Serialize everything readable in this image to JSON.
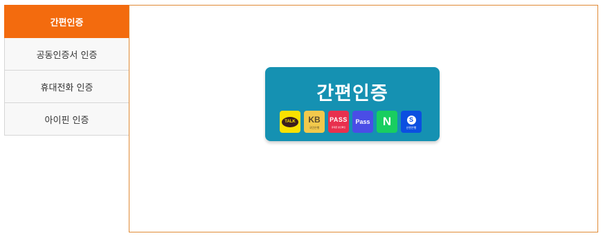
{
  "tabs": [
    {
      "label": "간편인증",
      "active": true
    },
    {
      "label": "공동인증서 인증",
      "active": false
    },
    {
      "label": "휴대전화 인증",
      "active": false
    },
    {
      "label": "아이핀 인증",
      "active": false
    }
  ],
  "auth_card": {
    "title": "간편인증",
    "providers": [
      {
        "icon": "kakaotalk-icon",
        "text": "TALK"
      },
      {
        "icon": "kb-bank-icon",
        "text": "KB",
        "sub": "국민은행"
      },
      {
        "icon": "pass-red-icon",
        "text": "PASS",
        "sub": "휴대폰 본인확인"
      },
      {
        "icon": "pass-blue-icon",
        "text": "Pass"
      },
      {
        "icon": "naver-icon",
        "text": "N"
      },
      {
        "icon": "shinhan-icon",
        "text": "S",
        "sub": "신한은행"
      }
    ]
  },
  "colors": {
    "active_tab": "#f36b0e",
    "panel_border": "#e08a35",
    "card_background": "#1591b2"
  }
}
